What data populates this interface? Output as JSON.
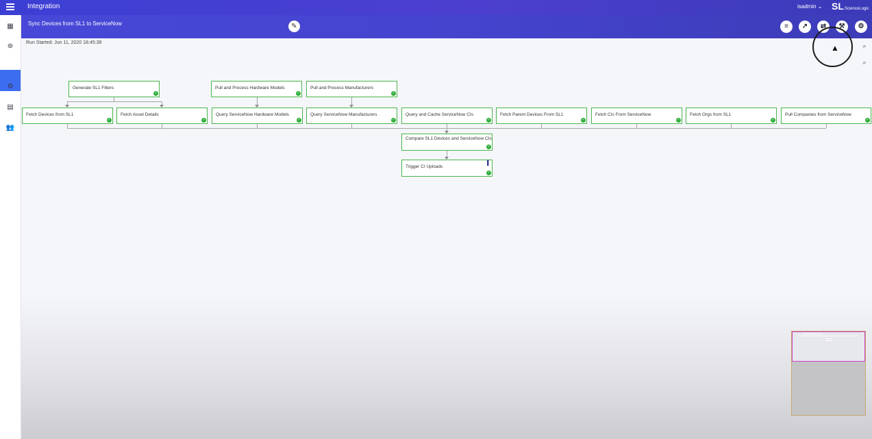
{
  "header": {
    "app_title": "Integration",
    "user": "isadmin ⌄",
    "logo_mark": "SL",
    "logo_text": "ScienceLogic"
  },
  "workflow": {
    "title": "Sync Devices from SL1 to ServiceNow",
    "run_started": "Run Started: Jun 11, 2020 18:45:39"
  },
  "toolbar": {
    "icons": [
      "list-icon",
      "trend-icon",
      "share-icon",
      "wrench-icon",
      "gear-icon"
    ]
  },
  "sidebar": {
    "items": [
      "dashboard-icon",
      "integration-icon",
      "steps-icon",
      "settings-icon",
      "document-icon",
      "users-icon"
    ]
  },
  "nodes": [
    {
      "label": "Generate SL1 Filters"
    },
    {
      "label": "Pull and Process Hardware Models"
    },
    {
      "label": "Pull and Process Manufacturers"
    },
    {
      "label": "Fetch Devices from SL1"
    },
    {
      "label": "Fetch Asset Details"
    },
    {
      "label": "Query ServiceNow Hardware Models"
    },
    {
      "label": "Query ServiceNow Manufacturers"
    },
    {
      "label": "Query and Cache ServiceNow CIs"
    },
    {
      "label": "Fetch Parent Devices From SL1"
    },
    {
      "label": "Fetch CIs From ServiceNow"
    },
    {
      "label": "Fetch Orgs from SL1"
    },
    {
      "label": "Pull Companies from ServiceNow"
    },
    {
      "label": "Compare SL1 Devices and ServiceNow CIs"
    },
    {
      "label": "Trigger CI Uploads"
    }
  ],
  "status": {
    "success_color": "#2fae3a",
    "accent_color": "#3c3fd4"
  }
}
